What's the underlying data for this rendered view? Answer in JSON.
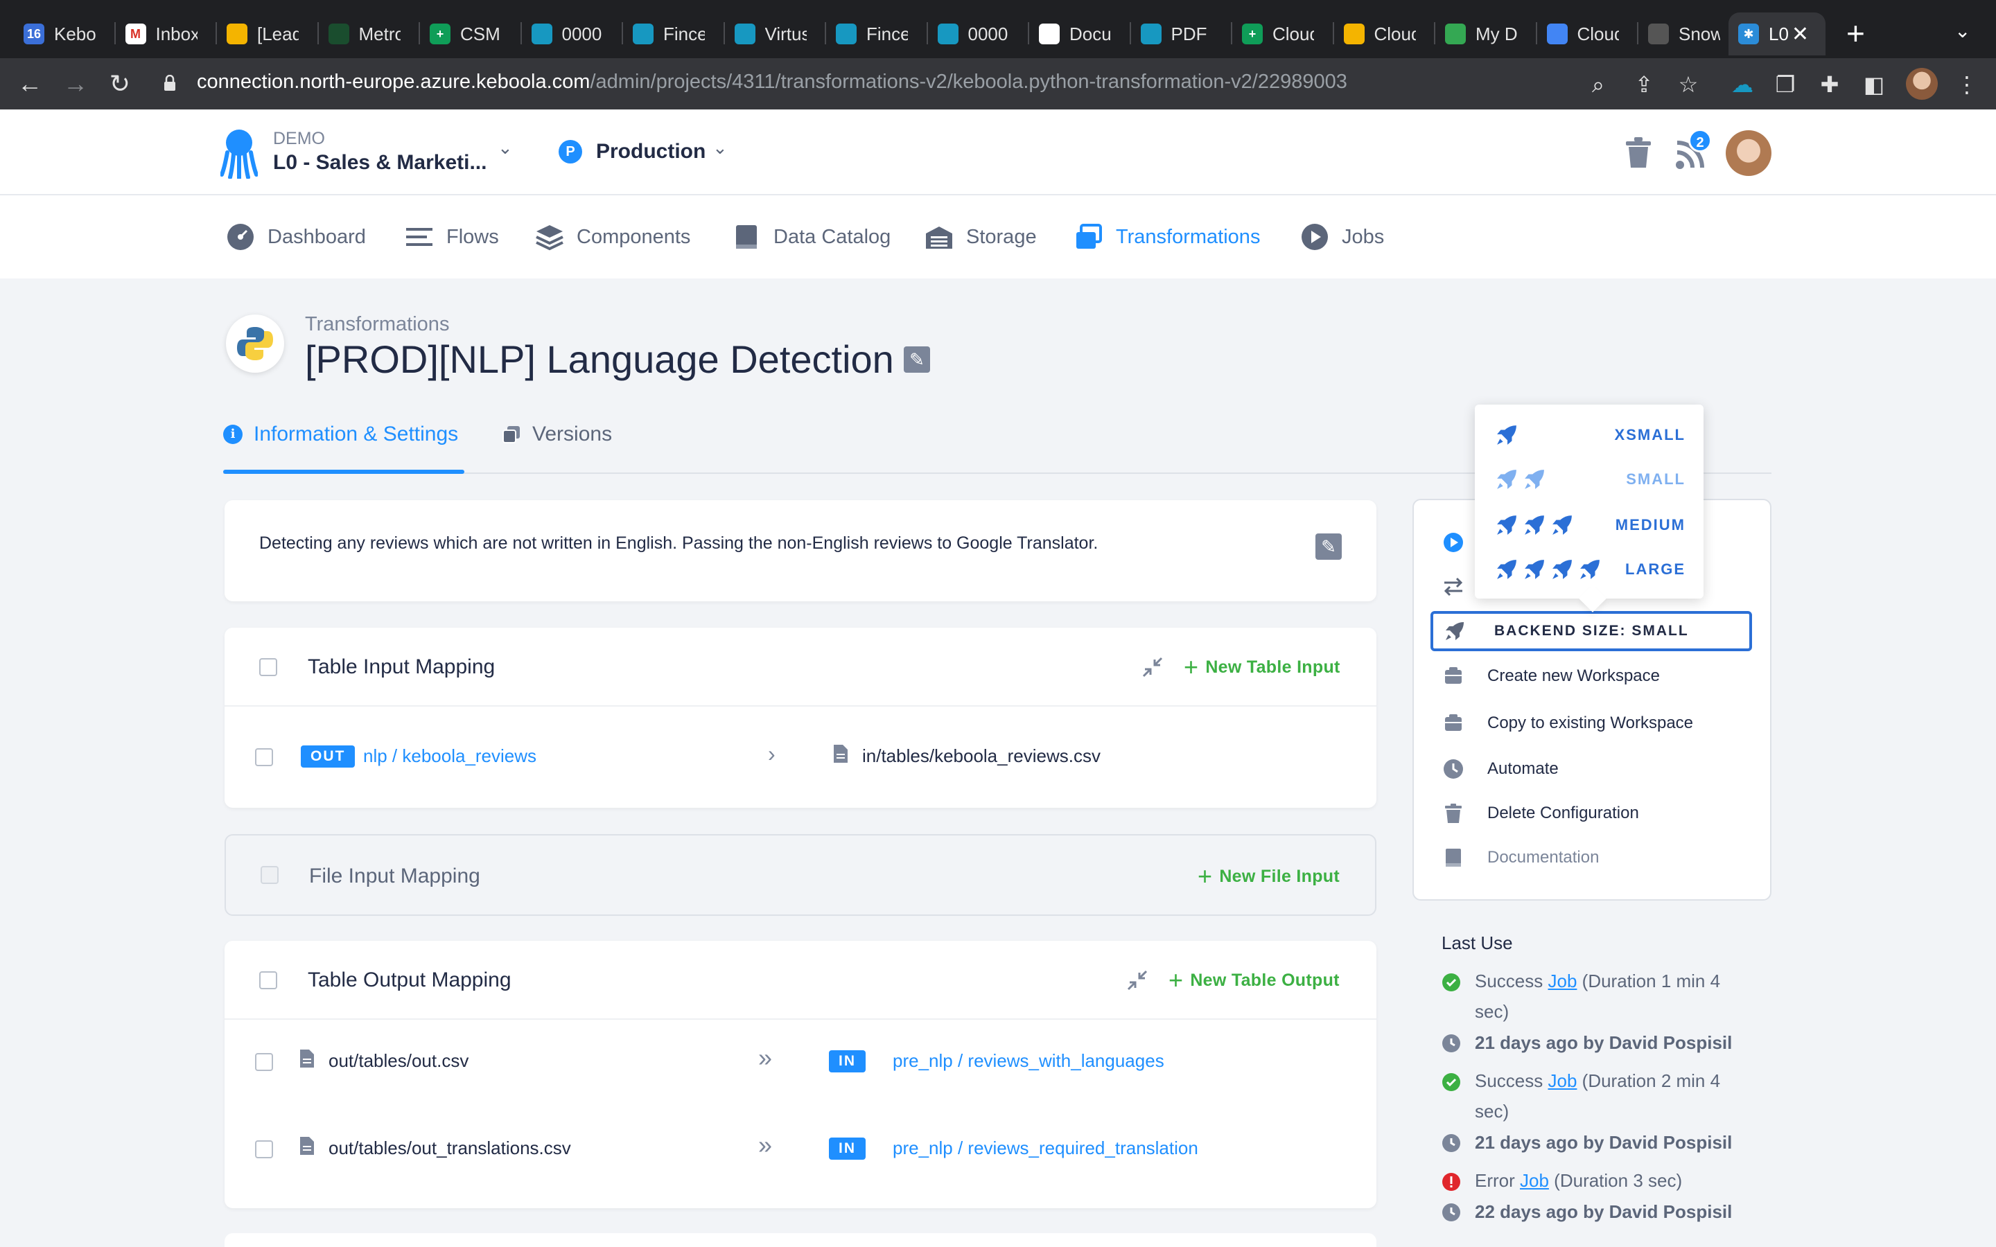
{
  "browser": {
    "tabs": [
      {
        "label": "Kebo",
        "color": "#3b6fd8",
        "glyph": "16"
      },
      {
        "label": "Inbox",
        "color": "#ffffff",
        "glyph": "M"
      },
      {
        "label": "[Lead",
        "color": "#f4b400",
        "glyph": ""
      },
      {
        "label": "Metro",
        "color": "#1a4d2e",
        "glyph": ""
      },
      {
        "label": "CSM:",
        "color": "#0f9d58",
        "glyph": "+"
      },
      {
        "label": "0000",
        "color": "#1798c1",
        "glyph": ""
      },
      {
        "label": "Fince",
        "color": "#1798c1",
        "glyph": ""
      },
      {
        "label": "Virtus",
        "color": "#1798c1",
        "glyph": ""
      },
      {
        "label": "Fince",
        "color": "#1798c1",
        "glyph": ""
      },
      {
        "label": "0000",
        "color": "#1798c1",
        "glyph": ""
      },
      {
        "label": "Docu",
        "color": "#ffffff",
        "glyph": ""
      },
      {
        "label": "PDF F",
        "color": "#1798c1",
        "glyph": ""
      },
      {
        "label": "Cloud",
        "color": "#0f9d58",
        "glyph": "+"
      },
      {
        "label": "Cloud",
        "color": "#f4b400",
        "glyph": ""
      },
      {
        "label": "My Dr",
        "color": "#34a853",
        "glyph": ""
      },
      {
        "label": "Cloud",
        "color": "#4285f4",
        "glyph": ""
      },
      {
        "label": "Snow",
        "color": "#555555",
        "glyph": ""
      }
    ],
    "active_tab": {
      "label": "L0",
      "close": "✕"
    },
    "new_tab": "+",
    "url_host": "connection.north-europe.azure.keboola.com",
    "url_path": "/admin/projects/4311/transformations-v2/keboola.python-transformation-v2/22989003"
  },
  "header": {
    "project_tag": "DEMO",
    "project_name": "L0 - Sales & Marketi...",
    "branch_initial": "P",
    "branch_name": "Production",
    "notification_count": "2"
  },
  "nav": {
    "items": [
      {
        "label": "Dashboard"
      },
      {
        "label": "Flows"
      },
      {
        "label": "Components"
      },
      {
        "label": "Data Catalog"
      },
      {
        "label": "Storage"
      },
      {
        "label": "Transformations"
      },
      {
        "label": "Jobs"
      }
    ],
    "active": "Transformations"
  },
  "page": {
    "breadcrumb": "Transformations",
    "title": "[PROD][NLP] Language Detection",
    "tabs": {
      "info": "Information & Settings",
      "versions": "Versions"
    },
    "description": "Detecting any reviews which are not written in English. Passing the non-English reviews to Google Translator."
  },
  "table_input": {
    "title": "Table Input Mapping",
    "add_label": "New Table Input",
    "rows": [
      {
        "badge": "OUT",
        "source": "nlp / keboola_reviews",
        "dest": "in/tables/keboola_reviews.csv"
      }
    ]
  },
  "file_input": {
    "title": "File Input Mapping",
    "add_label": "New File Input"
  },
  "table_output": {
    "title": "Table Output Mapping",
    "add_label": "New Table Output",
    "rows": [
      {
        "source": "out/tables/out.csv",
        "badge": "IN",
        "dest": "pre_nlp / reviews_with_languages"
      },
      {
        "source": "out/tables/out_translations.csv",
        "badge": "IN",
        "dest": "pre_nlp / reviews_required_translation"
      }
    ]
  },
  "backend_popover": {
    "options": [
      {
        "label": "XSMALL",
        "rockets": 1
      },
      {
        "label": "SMALL",
        "rockets": 2
      },
      {
        "label": "MEDIUM",
        "rockets": 3
      },
      {
        "label": "LARGE",
        "rockets": 4
      }
    ],
    "selected": "SMALL"
  },
  "sidebar": {
    "backend_button": "BACKEND SIZE: SMALL",
    "actions": [
      {
        "label": "Create new Workspace"
      },
      {
        "label": "Copy to existing Workspace"
      },
      {
        "label": "Automate"
      },
      {
        "label": "Delete Configuration"
      },
      {
        "label": "Documentation"
      }
    ]
  },
  "last_use": {
    "title": "Last Use",
    "entries": [
      {
        "status": "Success",
        "link": "Job",
        "detail": "(Duration 1 min 4 sec)",
        "when": "21 days ago by David Pospisil",
        "status_color": "#3cb043"
      },
      {
        "status": "Success",
        "link": "Job",
        "detail": "(Duration 2 min 4 sec)",
        "when": "21 days ago by David Pospisil",
        "status_color": "#3cb043"
      },
      {
        "status": "Error",
        "link": "Job",
        "detail": "(Duration 3 sec)",
        "when": "22 days ago by David Pospisil",
        "status_color": "#e0262c"
      }
    ]
  },
  "colors": {
    "accent": "#1f8fff",
    "success": "#3cb043",
    "error": "#e0262c"
  }
}
